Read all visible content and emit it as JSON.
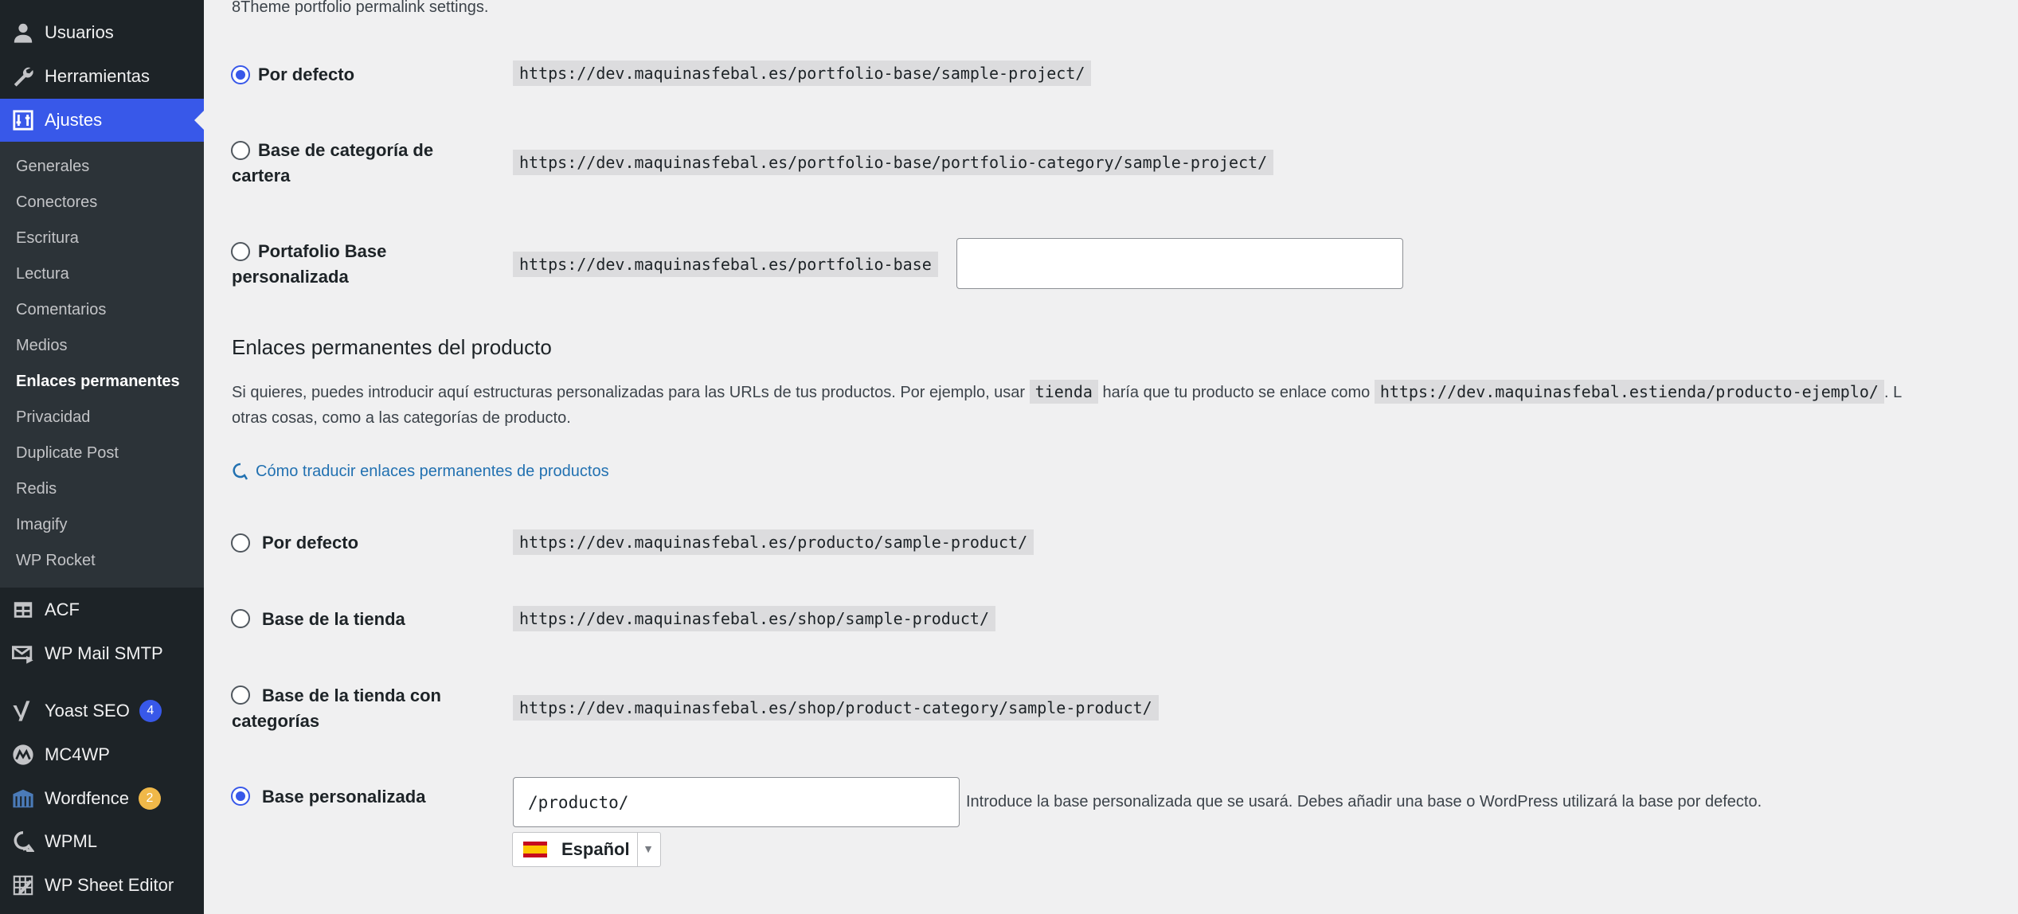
{
  "sidebar": {
    "top_items": [
      {
        "label": "Usuarios",
        "icon": "user-icon"
      },
      {
        "label": "Herramientas",
        "icon": "wrench-icon"
      },
      {
        "label": "Ajustes",
        "icon": "settings-icon"
      }
    ],
    "submenu": [
      "Generales",
      "Conectores",
      "Escritura",
      "Lectura",
      "Comentarios",
      "Medios",
      "Enlaces permanentes",
      "Privacidad",
      "Duplicate Post",
      "Redis",
      "Imagify",
      "WP Rocket"
    ],
    "active_submenu": "Enlaces permanentes",
    "plugins": [
      {
        "label": "ACF",
        "icon": "table-icon"
      },
      {
        "label": "WP Mail SMTP",
        "icon": "mail-icon"
      },
      {
        "label": "Yoast SEO",
        "icon": "yoast-icon",
        "badge": "4",
        "badge_color": "#3858e9"
      },
      {
        "label": "MC4WP",
        "icon": "mc4wp-icon"
      },
      {
        "label": "Wordfence",
        "icon": "wordfence-icon",
        "badge": "2",
        "badge_color": "#f0b849"
      },
      {
        "label": "WPML",
        "icon": "wpml-icon"
      },
      {
        "label": "WP Sheet Editor",
        "icon": "sheet-editor-icon"
      }
    ]
  },
  "portfolio": {
    "intro": "8Theme portfolio permalink settings.",
    "options": [
      {
        "label": "Por defecto",
        "url": "https://dev.maquinasfebal.es/portfolio-base/sample-project/",
        "checked": true
      },
      {
        "label_line1": "Base de categoría de",
        "label_line2": "cartera",
        "url": "https://dev.maquinasfebal.es/portfolio-base/portfolio-category/sample-project/",
        "checked": false
      },
      {
        "label_line1": "Portafolio Base",
        "label_line2": "personalizada",
        "url": "https://dev.maquinasfebal.es/portfolio-base",
        "input_value": "",
        "checked": false
      }
    ]
  },
  "product": {
    "heading": "Enlaces permanentes del producto",
    "desc_part1": "Si quieres, puedes introducir aquí estructuras personalizadas para las URLs de tus productos. Por ejemplo, usar",
    "desc_code1": "tienda",
    "desc_part2": "haría que tu producto se enlace como",
    "desc_code2": "https://dev.maquinasfebal.estienda/producto-ejemplo/",
    "desc_part3": ". L",
    "desc_line2": "otras cosas, como a las categorías de producto.",
    "help_link": "Cómo traducir enlaces permanentes de productos",
    "options": [
      {
        "label": "Por defecto",
        "url": "https://dev.maquinasfebal.es/producto/sample-product/",
        "checked": false
      },
      {
        "label": "Base de la tienda",
        "url": "https://dev.maquinasfebal.es/shop/sample-product/",
        "checked": false
      },
      {
        "label_line1": "Base de la tienda con",
        "label_line2": "categorías",
        "url": "https://dev.maquinasfebal.es/shop/product-category/sample-product/",
        "checked": false
      },
      {
        "label": "Base personalizada",
        "input_value": "/producto/",
        "hint": "Introduce la base personalizada que se usará. Debes añadir una base o WordPress utilizará la base por defecto.",
        "checked": true
      }
    ],
    "language": "Español"
  }
}
